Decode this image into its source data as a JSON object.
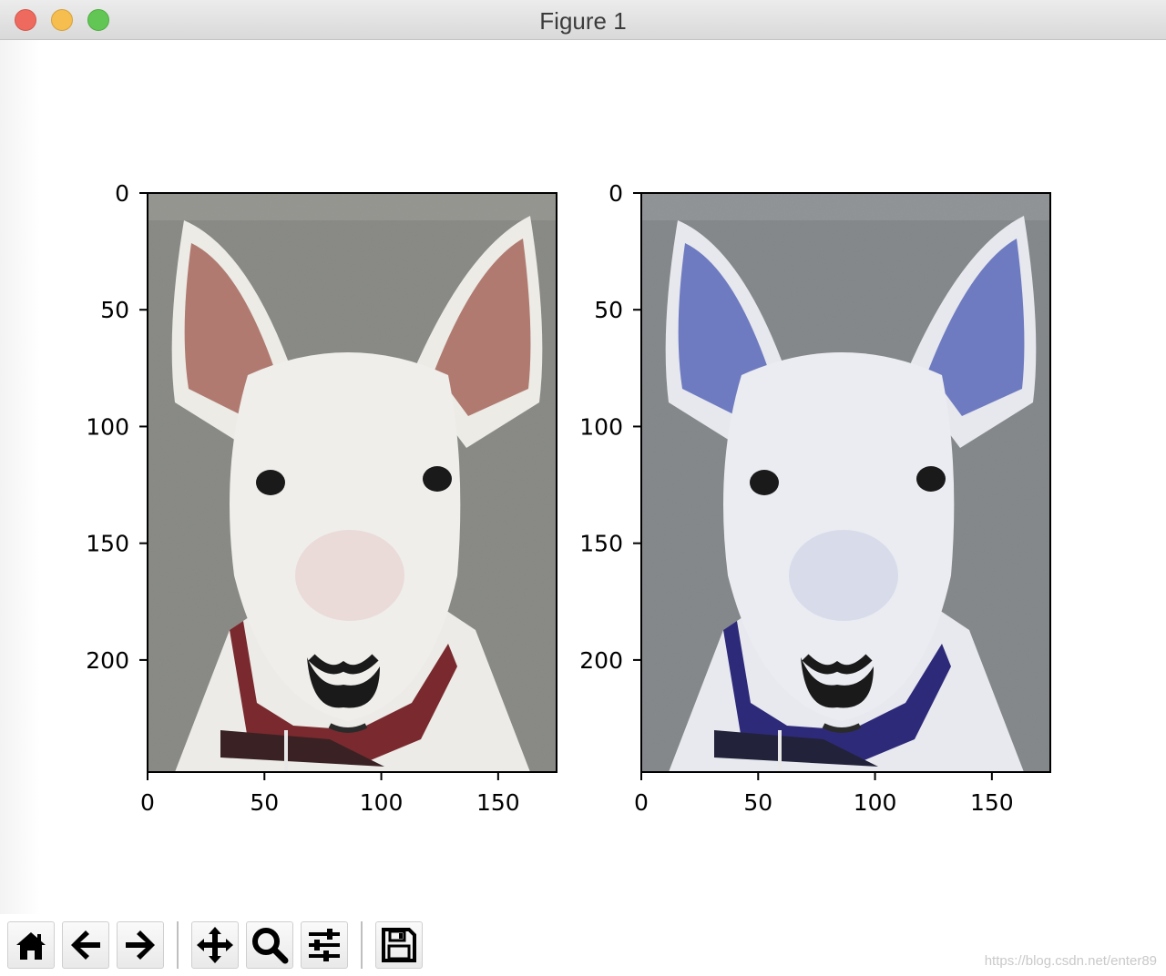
{
  "window": {
    "title": "Figure 1"
  },
  "figure": {
    "subplots": [
      {
        "name": "original-image",
        "description_colors": {
          "ear": "#b07a70",
          "collar": "#7a2a2e",
          "background": "#8a8a86"
        },
        "x_ticks": [
          "0",
          "50",
          "100",
          "150"
        ],
        "y_ticks": [
          "0",
          "50",
          "100",
          "150",
          "200"
        ]
      },
      {
        "name": "color-swapped-image",
        "description_colors": {
          "ear": "#6f7bc0",
          "collar": "#2e2a7a",
          "background": "#86898a"
        },
        "x_ticks": [
          "0",
          "50",
          "100",
          "150"
        ],
        "y_ticks": [
          "0",
          "50",
          "100",
          "150",
          "200"
        ]
      }
    ],
    "x_tick_values": [
      0,
      50,
      100,
      150
    ],
    "y_tick_values": [
      0,
      50,
      100,
      150,
      200
    ],
    "image_extent": {
      "x": [
        0,
        175
      ],
      "y": [
        0,
        248
      ]
    }
  },
  "toolbar": {
    "buttons": [
      {
        "name": "home-button",
        "icon": "home-icon"
      },
      {
        "name": "back-button",
        "icon": "arrow-left-icon"
      },
      {
        "name": "forward-button",
        "icon": "arrow-right-icon"
      },
      {
        "name": "pan-button",
        "icon": "move-icon"
      },
      {
        "name": "zoom-button",
        "icon": "magnifier-icon"
      },
      {
        "name": "configure-subplots-button",
        "icon": "sliders-icon"
      },
      {
        "name": "save-button",
        "icon": "floppy-disk-icon"
      }
    ]
  },
  "watermark": {
    "text": "https://blog.csdn.net/enter89"
  }
}
